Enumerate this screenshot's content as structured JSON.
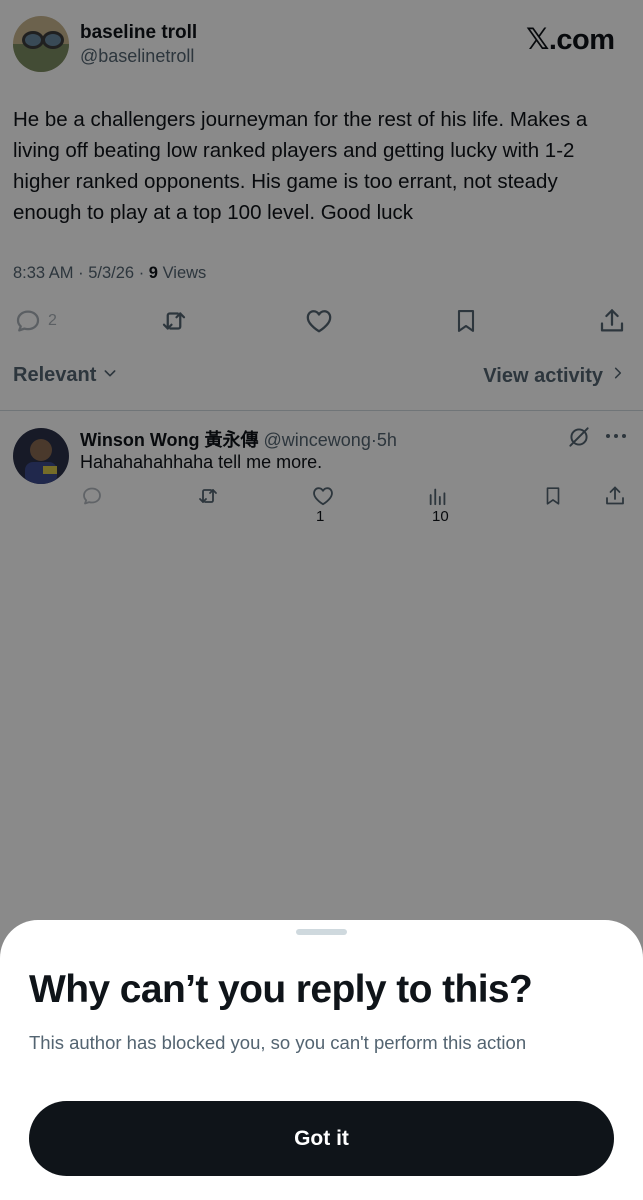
{
  "header": {
    "author_name": "baseline troll",
    "author_handle": "@baselinetroll",
    "brand": "𝕏.com"
  },
  "tweet": {
    "text": "He be a challengers journeyman for the rest of his life. Makes a living off beating low ranked players and getting lucky with 1-2 higher ranked opponents. His game is too errant, not steady enough to play at a top 100 level. Good luck",
    "time": "8:33 AM",
    "date": "5/3/26",
    "separator": "·",
    "views_count": "9",
    "views_label": "Views",
    "reply_count": "2",
    "icons": [
      "reply-icon",
      "retweet-icon",
      "like-icon",
      "bookmark-icon",
      "share-icon"
    ]
  },
  "sort": {
    "label": "Relevant",
    "view_activity": "View activity"
  },
  "reply": {
    "name": "Winson Wong 黃永傳",
    "handle": "@wincewong",
    "separator": "·",
    "time": "5h",
    "text": "Hahahahahhaha tell me more.",
    "like_count": "1",
    "views_count": "10",
    "icons": [
      "reply-icon",
      "retweet-icon",
      "like-icon",
      "views-icon",
      "bookmark-icon",
      "share-icon",
      "muted-icon",
      "more-icon"
    ]
  },
  "sheet": {
    "title": "Why can’t you reply to this?",
    "body": "This author has blocked you, so you can't perform this action",
    "button_label": "Got it"
  },
  "colors": {
    "text_primary": "#0f1419",
    "text_secondary": "#536471",
    "divider": "#cfd9de",
    "button_bg": "#0f1419",
    "overlay": "rgba(0,0,0,0.46)"
  }
}
